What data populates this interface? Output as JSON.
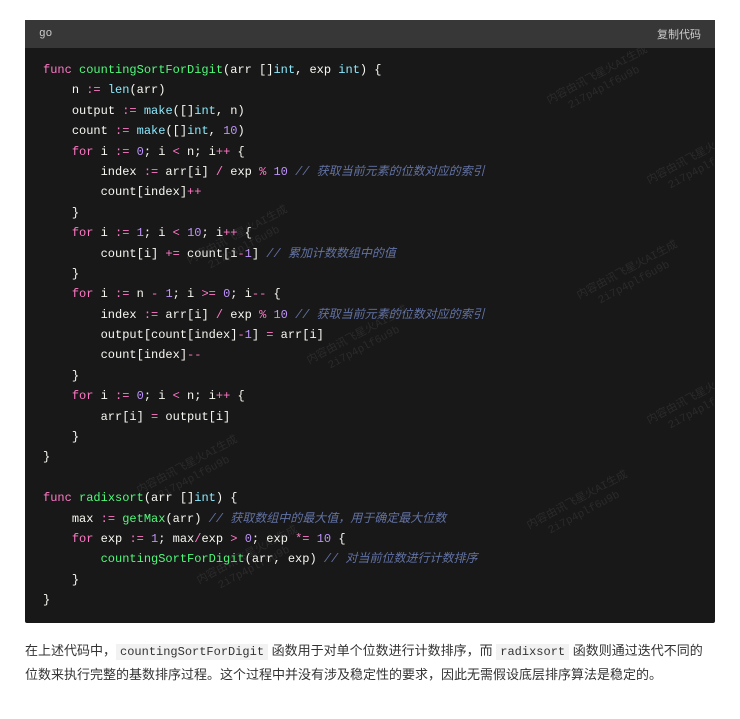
{
  "header": {
    "lang": "go",
    "copy_label": "复制代码"
  },
  "watermark": {
    "line1": "内容由讯飞星火AI生成",
    "line2": "2i7p4plf6u9b"
  },
  "code": {
    "lines": [
      [
        [
          "kw",
          "func"
        ],
        [
          "sp",
          " "
        ],
        [
          "fn",
          "countingSortForDigit"
        ],
        [
          "pun",
          "(arr []"
        ],
        [
          "ty",
          "int"
        ],
        [
          "pun",
          ", exp "
        ],
        [
          "ty",
          "int"
        ],
        [
          "pun",
          ") {"
        ]
      ],
      [
        [
          "sp",
          "    "
        ],
        [
          "id",
          "n "
        ],
        [
          "op",
          ":="
        ],
        [
          "sp",
          " "
        ],
        [
          "bi",
          "len"
        ],
        [
          "pun",
          "(arr)"
        ]
      ],
      [
        [
          "sp",
          "    "
        ],
        [
          "id",
          "output "
        ],
        [
          "op",
          ":="
        ],
        [
          "sp",
          " "
        ],
        [
          "bi",
          "make"
        ],
        [
          "pun",
          "([]"
        ],
        [
          "ty",
          "int"
        ],
        [
          "pun",
          ", n)"
        ]
      ],
      [
        [
          "sp",
          "    "
        ],
        [
          "id",
          "count "
        ],
        [
          "op",
          ":="
        ],
        [
          "sp",
          " "
        ],
        [
          "bi",
          "make"
        ],
        [
          "pun",
          "([]"
        ],
        [
          "ty",
          "int"
        ],
        [
          "pun",
          ", "
        ],
        [
          "num",
          "10"
        ],
        [
          "pun",
          ")"
        ]
      ],
      [
        [
          "sp",
          "    "
        ],
        [
          "kw",
          "for"
        ],
        [
          "sp",
          " "
        ],
        [
          "id",
          "i "
        ],
        [
          "op",
          ":="
        ],
        [
          "sp",
          " "
        ],
        [
          "num",
          "0"
        ],
        [
          "pun",
          "; i "
        ],
        [
          "op",
          "<"
        ],
        [
          "pun",
          " n; i"
        ],
        [
          "op",
          "++"
        ],
        [
          "pun",
          " {"
        ]
      ],
      [
        [
          "sp",
          "        "
        ],
        [
          "id",
          "index "
        ],
        [
          "op",
          ":="
        ],
        [
          "pun",
          " arr[i] "
        ],
        [
          "op",
          "/"
        ],
        [
          "pun",
          " exp "
        ],
        [
          "op",
          "%"
        ],
        [
          "sp",
          " "
        ],
        [
          "num",
          "10"
        ],
        [
          "sp",
          " "
        ],
        [
          "cm",
          "// 获取当前元素的位数对应的索引"
        ]
      ],
      [
        [
          "sp",
          "        "
        ],
        [
          "id",
          "count[index]"
        ],
        [
          "op",
          "++"
        ]
      ],
      [
        [
          "sp",
          "    "
        ],
        [
          "pun",
          "}"
        ]
      ],
      [
        [
          "sp",
          "    "
        ],
        [
          "kw",
          "for"
        ],
        [
          "sp",
          " "
        ],
        [
          "id",
          "i "
        ],
        [
          "op",
          ":="
        ],
        [
          "sp",
          " "
        ],
        [
          "num",
          "1"
        ],
        [
          "pun",
          "; i "
        ],
        [
          "op",
          "<"
        ],
        [
          "sp",
          " "
        ],
        [
          "num",
          "10"
        ],
        [
          "pun",
          "; i"
        ],
        [
          "op",
          "++"
        ],
        [
          "pun",
          " {"
        ]
      ],
      [
        [
          "sp",
          "        "
        ],
        [
          "id",
          "count[i] "
        ],
        [
          "op",
          "+="
        ],
        [
          "pun",
          " count[i"
        ],
        [
          "op",
          "-"
        ],
        [
          "num",
          "1"
        ],
        [
          "pun",
          "] "
        ],
        [
          "cm",
          "// 累加计数数组中的值"
        ]
      ],
      [
        [
          "sp",
          "    "
        ],
        [
          "pun",
          "}"
        ]
      ],
      [
        [
          "sp",
          "    "
        ],
        [
          "kw",
          "for"
        ],
        [
          "sp",
          " "
        ],
        [
          "id",
          "i "
        ],
        [
          "op",
          ":="
        ],
        [
          "pun",
          " n "
        ],
        [
          "op",
          "-"
        ],
        [
          "sp",
          " "
        ],
        [
          "num",
          "1"
        ],
        [
          "pun",
          "; i "
        ],
        [
          "op",
          ">="
        ],
        [
          "sp",
          " "
        ],
        [
          "num",
          "0"
        ],
        [
          "pun",
          "; i"
        ],
        [
          "op",
          "--"
        ],
        [
          "pun",
          " {"
        ]
      ],
      [
        [
          "sp",
          "        "
        ],
        [
          "id",
          "index "
        ],
        [
          "op",
          ":="
        ],
        [
          "pun",
          " arr[i] "
        ],
        [
          "op",
          "/"
        ],
        [
          "pun",
          " exp "
        ],
        [
          "op",
          "%"
        ],
        [
          "sp",
          " "
        ],
        [
          "num",
          "10"
        ],
        [
          "sp",
          " "
        ],
        [
          "cm",
          "// 获取当前元素的位数对应的索引"
        ]
      ],
      [
        [
          "sp",
          "        "
        ],
        [
          "id",
          "output[count[index]"
        ],
        [
          "op",
          "-"
        ],
        [
          "num",
          "1"
        ],
        [
          "pun",
          "] "
        ],
        [
          "op",
          "="
        ],
        [
          "pun",
          " arr[i]"
        ]
      ],
      [
        [
          "sp",
          "        "
        ],
        [
          "id",
          "count[index]"
        ],
        [
          "op",
          "--"
        ]
      ],
      [
        [
          "sp",
          "    "
        ],
        [
          "pun",
          "}"
        ]
      ],
      [
        [
          "sp",
          "    "
        ],
        [
          "kw",
          "for"
        ],
        [
          "sp",
          " "
        ],
        [
          "id",
          "i "
        ],
        [
          "op",
          ":="
        ],
        [
          "sp",
          " "
        ],
        [
          "num",
          "0"
        ],
        [
          "pun",
          "; i "
        ],
        [
          "op",
          "<"
        ],
        [
          "pun",
          " n; i"
        ],
        [
          "op",
          "++"
        ],
        [
          "pun",
          " {"
        ]
      ],
      [
        [
          "sp",
          "        "
        ],
        [
          "id",
          "arr[i] "
        ],
        [
          "op",
          "="
        ],
        [
          "pun",
          " output[i]"
        ]
      ],
      [
        [
          "sp",
          "    "
        ],
        [
          "pun",
          "}"
        ]
      ],
      [
        [
          "pun",
          "}"
        ]
      ],
      [
        [
          "sp",
          " "
        ]
      ],
      [
        [
          "kw",
          "func"
        ],
        [
          "sp",
          " "
        ],
        [
          "fn",
          "radixsort"
        ],
        [
          "pun",
          "(arr []"
        ],
        [
          "ty",
          "int"
        ],
        [
          "pun",
          ") {"
        ]
      ],
      [
        [
          "sp",
          "    "
        ],
        [
          "id",
          "max "
        ],
        [
          "op",
          ":="
        ],
        [
          "sp",
          " "
        ],
        [
          "fn",
          "getMax"
        ],
        [
          "pun",
          "(arr) "
        ],
        [
          "cm",
          "// 获取数组中的最大值，用于确定最大位数"
        ]
      ],
      [
        [
          "sp",
          "    "
        ],
        [
          "kw",
          "for"
        ],
        [
          "sp",
          " "
        ],
        [
          "id",
          "exp "
        ],
        [
          "op",
          ":="
        ],
        [
          "sp",
          " "
        ],
        [
          "num",
          "1"
        ],
        [
          "pun",
          "; max"
        ],
        [
          "op",
          "/"
        ],
        [
          "pun",
          "exp "
        ],
        [
          "op",
          ">"
        ],
        [
          "sp",
          " "
        ],
        [
          "num",
          "0"
        ],
        [
          "pun",
          "; exp "
        ],
        [
          "op",
          "*="
        ],
        [
          "sp",
          " "
        ],
        [
          "num",
          "10"
        ],
        [
          "pun",
          " {"
        ]
      ],
      [
        [
          "sp",
          "        "
        ],
        [
          "fn",
          "countingSortForDigit"
        ],
        [
          "pun",
          "(arr, exp) "
        ],
        [
          "cm",
          "// 对当前位数进行计数排序"
        ]
      ],
      [
        [
          "sp",
          "    "
        ],
        [
          "pun",
          "}"
        ]
      ],
      [
        [
          "pun",
          "}"
        ]
      ]
    ]
  },
  "description": {
    "parts": [
      "在上述代码中，",
      {
        "code": "countingSortForDigit"
      },
      " 函数用于对单个位数进行计数排序，而 ",
      {
        "code": "radixsort"
      },
      " 函数则通过迭代不同的位数来执行完整的基数排序过程。这个过程中并没有涉及稳定性的要求，因此无需假设底层排序算法是稳定的。"
    ]
  }
}
